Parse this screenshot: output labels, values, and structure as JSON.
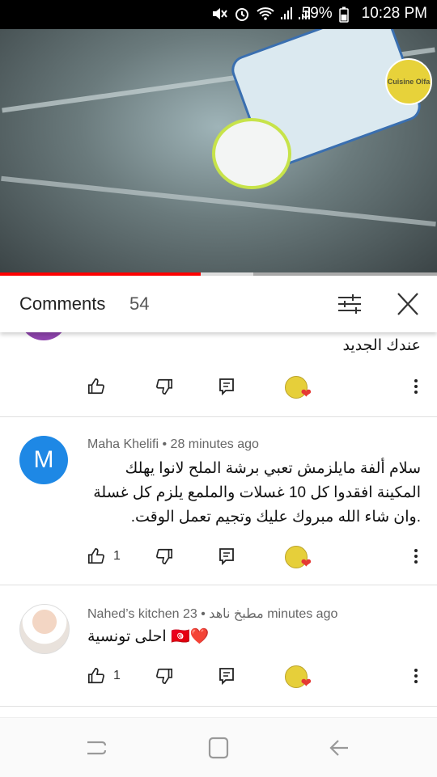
{
  "status": {
    "battery": "59%",
    "time": "10:28 PM"
  },
  "video": {
    "channel_logo_text": "Cuisine Olfa",
    "progress_fraction": 0.46,
    "buffer_fraction": 0.58
  },
  "comments_panel": {
    "title": "Comments",
    "count": "54"
  },
  "comments": [
    {
      "author": "",
      "text": "عندك الجديد",
      "likes": ""
    },
    {
      "author": "Maha Khelifi • 28 minutes ago",
      "avatar_letter": "M",
      "text": "سلام ألفة مايلزمش تعبي برشة الملح لانوا يهلك المكينة افقدوا كل 10 غسلات والملمع يلزم كل غسلة .وان شاء الله مبروك عليك  وتجيم تعمل الوقت.",
      "likes": "1"
    },
    {
      "author": "Nahed’s kitchen مطبخ ناهد • 23 minutes ago",
      "text": "احلى تونسية 🇹🇳❤️",
      "likes": "1"
    }
  ],
  "colors": {
    "accent_red": "#ff0000",
    "avatar_blue": "#1e88e5",
    "heart_red": "#e53935"
  }
}
